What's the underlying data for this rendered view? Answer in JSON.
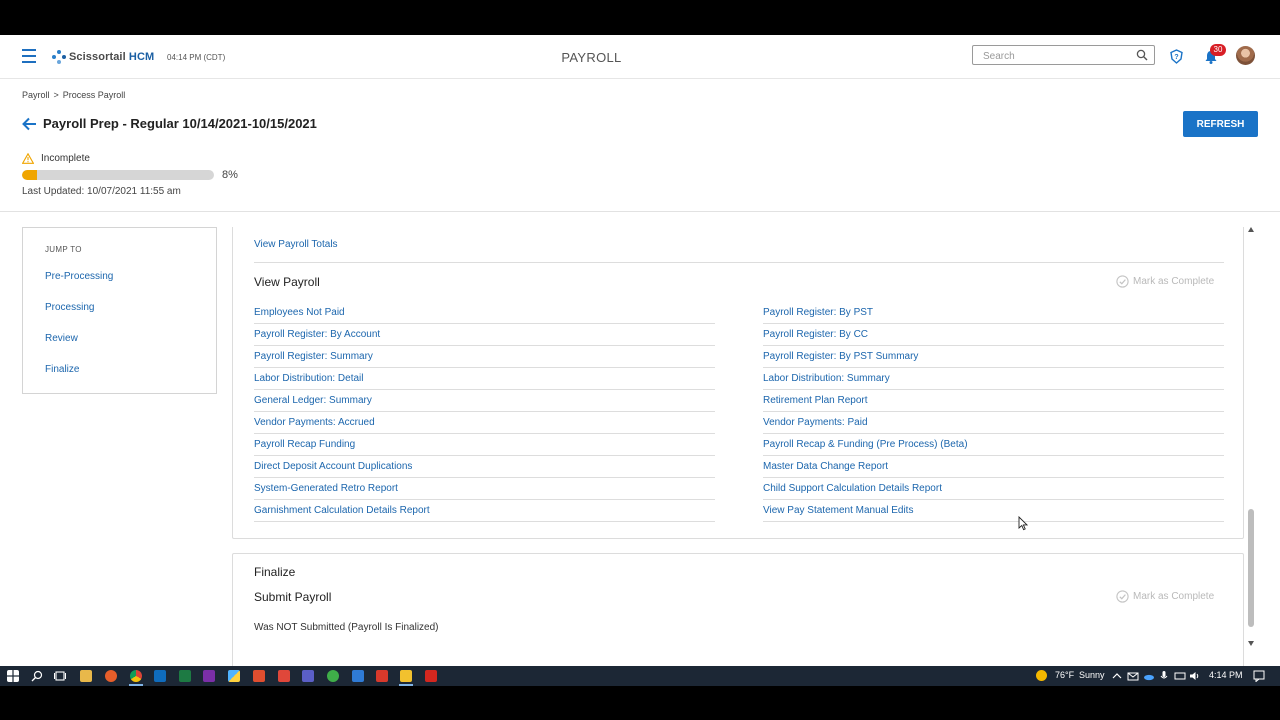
{
  "header": {
    "logo_text_a": "Scissortail",
    "logo_text_b": "HCM",
    "clock": "04:14 PM (CDT)",
    "app_title": "PAYROLL",
    "search_placeholder": "Search",
    "notification_count": "30"
  },
  "breadcrumb": [
    "Payroll",
    ">",
    "Process Payroll"
  ],
  "page": {
    "title": "Payroll Prep - Regular 10/14/2021-10/15/2021",
    "refresh_label": "REFRESH",
    "status": "Incomplete",
    "progress_percent": 8,
    "progress_label": "8%",
    "last_updated": "Last Updated: 10/07/2021 11:55 am"
  },
  "jump_to": {
    "heading": "JUMP TO",
    "links": [
      "Pre-Processing",
      "Processing",
      "Review",
      "Finalize"
    ]
  },
  "view_payroll": {
    "totals_link": "View Payroll Totals",
    "title": "View Payroll",
    "mark_complete": "Mark as Complete",
    "left_reports": [
      "Employees Not Paid",
      "Payroll Register: By Account",
      "Payroll Register: Summary",
      "Labor Distribution: Detail",
      "General Ledger: Summary",
      "Vendor Payments: Accrued",
      "Payroll Recap Funding",
      "Direct Deposit Account Duplications",
      "System-Generated Retro Report",
      "Garnishment Calculation Details Report"
    ],
    "right_reports": [
      "Payroll Register: By PST",
      "Payroll Register: By CC",
      "Payroll Register: By PST Summary",
      "Labor Distribution: Summary",
      "Retirement Plan Report",
      "Vendor Payments: Paid",
      "Payroll Recap & Funding (Pre Process) (Beta)",
      "Master Data Change Report",
      "Child Support Calculation Details Report",
      "View Pay Statement Manual Edits"
    ]
  },
  "finalize": {
    "title": "Finalize",
    "submit_title": "Submit Payroll",
    "mark_complete": "Mark as Complete",
    "submit_status": "Was NOT Submitted (Payroll Is Finalized)"
  },
  "taskbar": {
    "weather": "76°F",
    "weather_text": "Sunny",
    "time": "4:14 PM"
  },
  "colors": {
    "accent": "#1a73c7",
    "link": "#1c66ad",
    "progress": "#f0a500",
    "warning": "#f0a500",
    "badge": "#d81f26"
  }
}
